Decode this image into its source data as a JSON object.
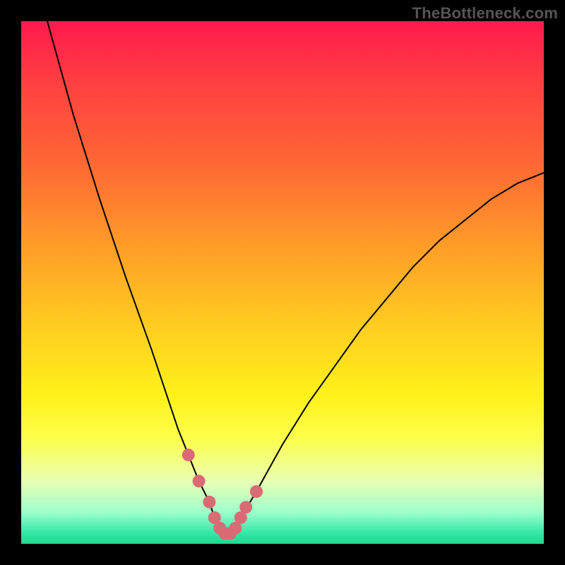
{
  "watermark": "TheBottleneck.com",
  "chart_data": {
    "type": "line",
    "title": "",
    "xlabel": "",
    "ylabel": "",
    "xlim": [
      0,
      100
    ],
    "ylim": [
      0,
      100
    ],
    "grid": false,
    "legend": false,
    "series": [
      {
        "name": "bottleneck-curve",
        "x": [
          5,
          10,
          15,
          20,
          25,
          28,
          30,
          32,
          34,
          36,
          37,
          38,
          39,
          40,
          41,
          42,
          45,
          50,
          55,
          60,
          65,
          70,
          75,
          80,
          85,
          90,
          95,
          100
        ],
        "y": [
          100,
          82,
          66,
          51,
          37,
          28,
          22,
          17,
          12,
          8,
          5,
          3,
          2,
          2,
          3,
          5,
          10,
          19,
          27,
          34,
          41,
          47,
          53,
          58,
          62,
          66,
          69,
          71
        ]
      }
    ],
    "highlight": {
      "name": "optimal-zone",
      "color": "#d96b74",
      "x": [
        32,
        34,
        36,
        37,
        38,
        39,
        40,
        41,
        42,
        43,
        45
      ],
      "y": [
        17,
        12,
        8,
        5,
        3,
        2,
        2,
        3,
        5,
        7,
        10
      ]
    }
  }
}
